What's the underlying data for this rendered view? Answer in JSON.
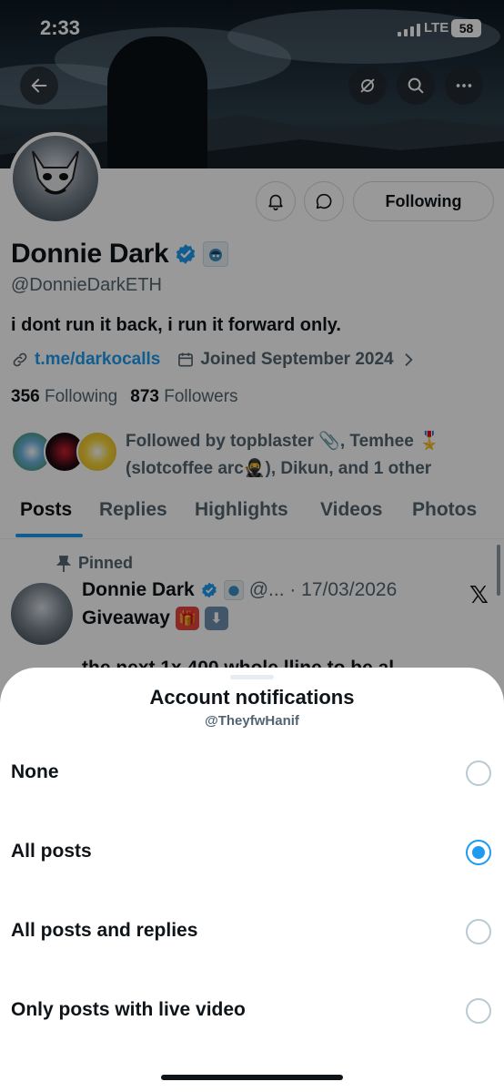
{
  "status_bar": {
    "time": "2:33",
    "network": "LTE",
    "battery": "58"
  },
  "profile": {
    "display_name": "Donnie Dark",
    "handle": "@DonnieDarkETH",
    "bio": "i dont run it back, i run it forward only.",
    "link": "t.me/darkocalls",
    "joined": "Joined September 2024",
    "following_count": "356",
    "following_label": "Following",
    "followers_count": "873",
    "followers_label": "Followers",
    "followed_by_line1": "Followed by topblaster 📎, Temhee 🎖️",
    "followed_by_line2": "(slotcoffee arc🥷), Dikun, and 1 other",
    "following_button": "Following"
  },
  "tabs": [
    {
      "label": "Posts",
      "active": true
    },
    {
      "label": "Replies"
    },
    {
      "label": "Highlights"
    },
    {
      "label": "Videos"
    },
    {
      "label": "Photos"
    }
  ],
  "post": {
    "pinned_label": "Pinned",
    "name": "Donnie Dark",
    "meta": "@... · 17/03/2026",
    "text": "Giveaway",
    "cut_text": "the next 1x 400 whole lline to be al"
  },
  "sheet": {
    "title": "Account notifications",
    "subtitle": "@TheyfwHanif",
    "options": [
      {
        "label": "None",
        "selected": false
      },
      {
        "label": "All posts",
        "selected": true
      },
      {
        "label": "All posts and replies",
        "selected": false
      },
      {
        "label": "Only posts with live video",
        "selected": false
      }
    ]
  },
  "colors": {
    "accent": "#1d9bf0",
    "text": "#0f1419",
    "muted": "#536471",
    "overlay": "rgba(0,0,0,0.4)"
  }
}
